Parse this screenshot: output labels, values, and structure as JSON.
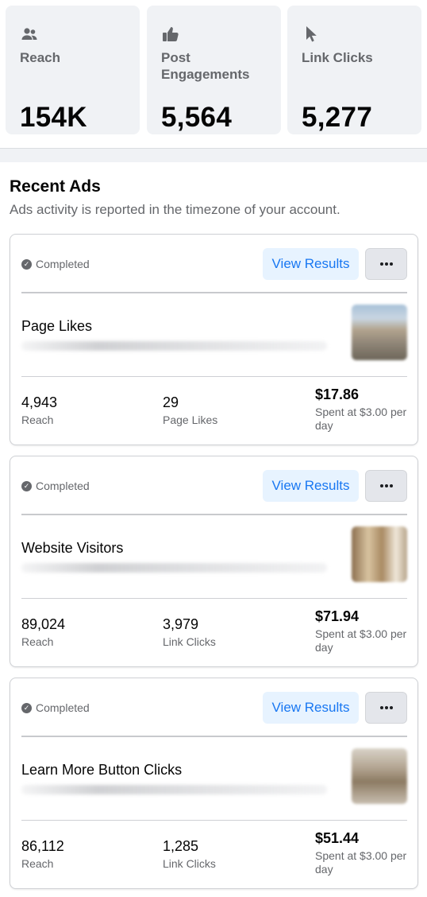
{
  "stats": [
    {
      "icon": "people-icon",
      "label": "Reach",
      "value": "154K"
    },
    {
      "icon": "thumbs-up-icon",
      "label": "Post Engagements",
      "value": "5,564"
    },
    {
      "icon": "cursor-icon",
      "label": "Link Clicks",
      "value": "5,277"
    }
  ],
  "recent_ads": {
    "title": "Recent Ads",
    "subtitle": "Ads activity is reported in the timezone of your account.",
    "ads": [
      {
        "status": "Completed",
        "view_results_label": "View Results",
        "more_label": "…",
        "title": "Page Likes",
        "metrics": [
          {
            "value": "4,943",
            "label": "Reach"
          },
          {
            "value": "29",
            "label": "Page Likes"
          },
          {
            "value": "$17.86",
            "label": "Spent at $3.00 per day"
          }
        ]
      },
      {
        "status": "Completed",
        "view_results_label": "View Results",
        "more_label": "…",
        "title": "Website Visitors",
        "metrics": [
          {
            "value": "89,024",
            "label": "Reach"
          },
          {
            "value": "3,979",
            "label": "Link Clicks"
          },
          {
            "value": "$71.94",
            "label": "Spent at $3.00 per day"
          }
        ]
      },
      {
        "status": "Completed",
        "view_results_label": "View Results",
        "more_label": "…",
        "title": "Learn More Button Clicks",
        "metrics": [
          {
            "value": "86,112",
            "label": "Reach"
          },
          {
            "value": "1,285",
            "label": "Link Clicks"
          },
          {
            "value": "$51.44",
            "label": "Spent at $3.00 per day"
          }
        ]
      }
    ]
  },
  "colors": {
    "accent": "#1877f2",
    "accent_bg": "#e7f3ff",
    "card_bg": "#f0f2f5",
    "muted_text": "#65676b"
  }
}
